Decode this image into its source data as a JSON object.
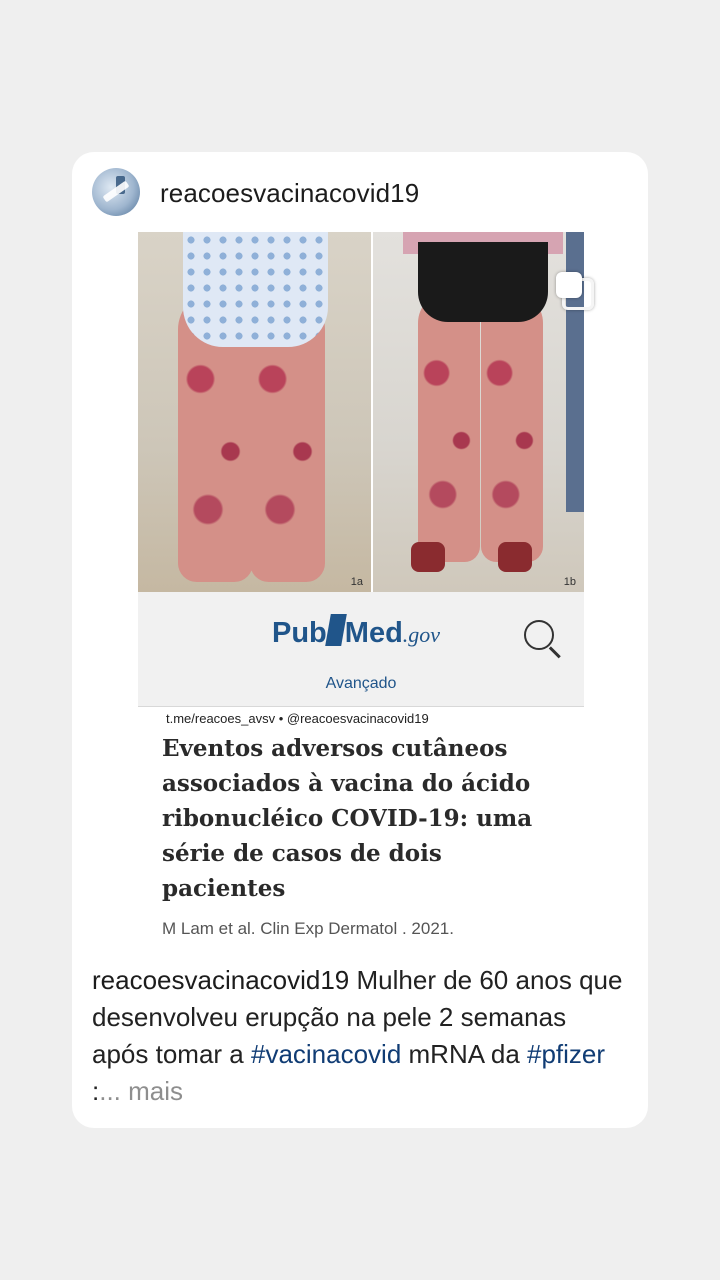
{
  "post": {
    "username": "reacoesvacinacovid19",
    "photo_labels": [
      "1a",
      "1b"
    ],
    "pubmed": {
      "logo_pub": "Pub",
      "logo_med": "Med",
      "logo_gov": ".gov",
      "advanced_link": "Avançado"
    },
    "article": {
      "source_line": "t.me/reacoes_avsv  •  @reacoesvacinacovid19",
      "title": "Eventos adversos cutâneos associados à vacina do ácido ribonucléico COVID-19: uma série de casos de dois pacientes",
      "citation": "M Lam  et al. Clin Exp Dermatol . 2021."
    },
    "caption": {
      "user": "reacoesvacinacovid19",
      "text1": " Mulher de 60 anos que desenvolveu erupção na pele 2 semanas após tomar a ",
      "hashtag1": "#vacinacovid",
      "text2": " mRNA da ",
      "hashtag2": "#pfizer",
      "text3": " :",
      "more": "... mais"
    }
  },
  "icons": {
    "avatar": "avatar-image",
    "multi_image": "carousel-stack-icon",
    "search": "search-icon"
  },
  "colors": {
    "background": "#efefef",
    "card": "#ffffff",
    "pubmed_blue": "#20558a",
    "hashtag": "#103c74",
    "more": "#8e8e8e"
  }
}
